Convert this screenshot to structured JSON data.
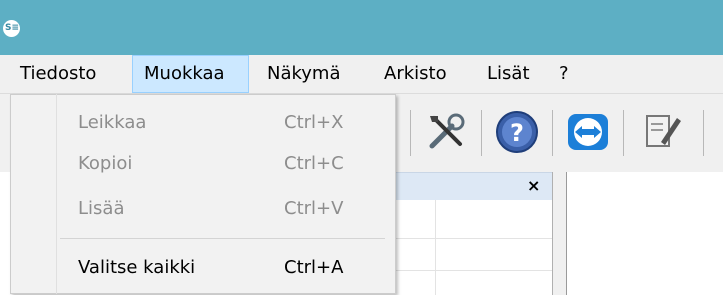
{
  "app": {
    "icon_glyph": "S≡"
  },
  "menubar": {
    "items": [
      {
        "label": "Tiedosto"
      },
      {
        "label": "Muokkaa"
      },
      {
        "label": "Näkymä"
      },
      {
        "label": "Arkisto"
      },
      {
        "label": "Lisät"
      },
      {
        "label": "?"
      }
    ],
    "active_index": 1
  },
  "toolbar": {
    "icons": [
      "tools-icon",
      "help-icon",
      "teamviewer-icon",
      "document-edit-icon"
    ]
  },
  "edit_menu": {
    "items": [
      {
        "label": "Leikkaa",
        "shortcut": "Ctrl+X",
        "enabled": false
      },
      {
        "label": "Kopioi",
        "shortcut": "Ctrl+C",
        "enabled": false
      },
      {
        "label": "Lisää",
        "shortcut": "Ctrl+V",
        "enabled": false
      },
      {
        "label": "Valitse kaikki",
        "shortcut": "Ctrl+A",
        "enabled": true
      }
    ]
  },
  "panel": {
    "close_glyph": "×"
  },
  "colors": {
    "titlebar": "#5dafc4",
    "menu_active_bg": "#cce8ff",
    "menu_active_border": "#99d1ff",
    "disabled_text": "#8d8d8d"
  }
}
